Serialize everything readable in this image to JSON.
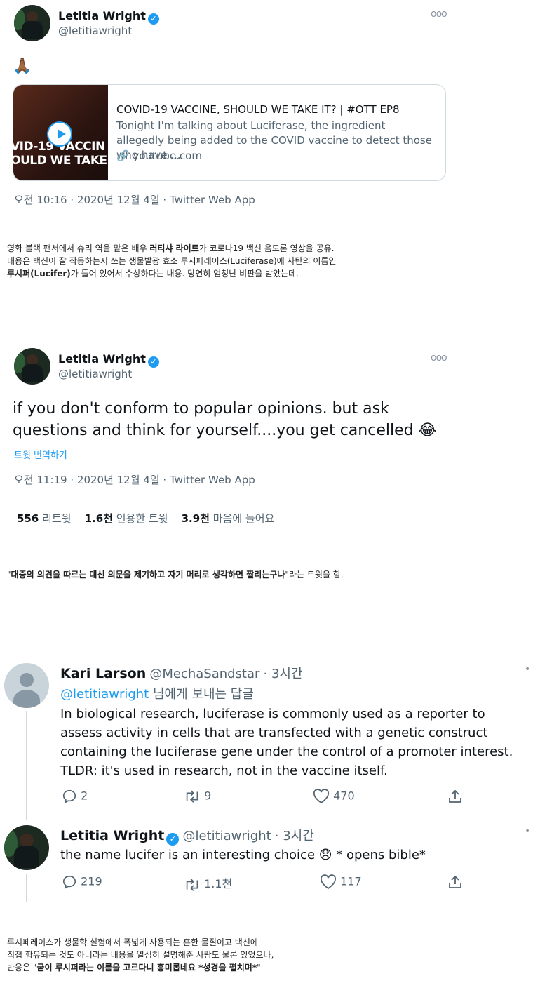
{
  "tweet1": {
    "name": "Letitia Wright",
    "handle": "@letitiawright",
    "more": "ooo",
    "emoji": "🙏🏾",
    "card": {
      "title": "COVID-19 VACCINE, SHOULD WE TAKE IT? | #OTT EP8",
      "description": "Tonight I'm talking about Luciferase, the ingredient allegedly being added to the COVID vaccine to detect those who have ...",
      "link": "youtube.com",
      "thumb_line1": "VID-19 VACCIN",
      "thumb_line2": "OULD WE TAKE"
    },
    "timestamp": "오전 10:16 · 2020년 12월 4일 · Twitter Web App"
  },
  "caption1": {
    "line1_pre": "영화 블랙 팬서에서 슈리 역을 맡은 배우 ",
    "line1_bold": "러티샤 라이트",
    "line1_post": "가 코로나19 백신 음모론 영상을 공유.",
    "line2": "내용은 백신이 잘 작동하는지 쓰는 생물발광 효소 루시페레이스(Luciferase)에 사탄의 이름인",
    "line3_bold": "루시퍼(Lucifer)",
    "line3_post": "가 들어 있어서 수상하다는 내용. 당연히 엄청난 비판을 받았는데."
  },
  "tweet2": {
    "name": "Letitia Wright",
    "handle": "@letitiawright",
    "more": "ooo",
    "text": "if you don't conform to popular opinions. but ask questions and think for yourself....you get cancelled 😂",
    "translate": "트윗 번역하기",
    "timestamp": "오전 11:19 · 2020년 12월 4일 · Twitter Web App",
    "retweets_value": "556",
    "retweets_label": "리트윗",
    "quotes_value": "1.6천",
    "quotes_label": "인용한 트윗",
    "likes_value": "3.9천",
    "likes_label": "마음에 들어요"
  },
  "caption2": {
    "open": "\"",
    "bold": "대중의 의견을 따르는 대신 의문을 제기하고 자기 머리로 생각하면 짤리는구나",
    "post": "\"라는 트윗을 함."
  },
  "reply1": {
    "name": "Kari Larson",
    "handle": "@MechaSandstar",
    "time": "· 3시간",
    "replying_to": "@letitiawright",
    "replying_suffix": "님에게 보내는 답글",
    "text": "In biological research, luciferase is commonly used as a reporter to assess activity in cells that are transfected with a genetic construct containing the luciferase gene under the control of a promoter interest.  TLDR: it's used in research, not in the vaccine itself.",
    "replies": "2",
    "retweets": "9",
    "likes": "470"
  },
  "reply2": {
    "name": "Letitia Wright",
    "handle": "@letitiawright",
    "time": "· 3시간",
    "text_pre": "the name lucifer is an interesting choice ",
    "emoji": "😞",
    "text_post": " * opens bible*",
    "replies": "219",
    "retweets": "1.1천",
    "likes": "117"
  },
  "caption3": {
    "line1": "루시페레이스가 생물학 실험에서 폭넓게 사용되는 흔한 물질이고 백신에",
    "line2": "직접 함유되는 것도 아니라는 내용을 열심히 설명해준 사람도 물론 있었으나,",
    "line3_pre": "반응은 \"",
    "line3_bold": "굳이 루시퍼라는 이름을 고르다니 흥미롭네요 *성경을 펼치며*",
    "line3_post": "\""
  },
  "colors": {
    "accent": "#1d9bf0",
    "muted": "#536471",
    "text": "#0f1419",
    "border": "#cfd9de"
  }
}
